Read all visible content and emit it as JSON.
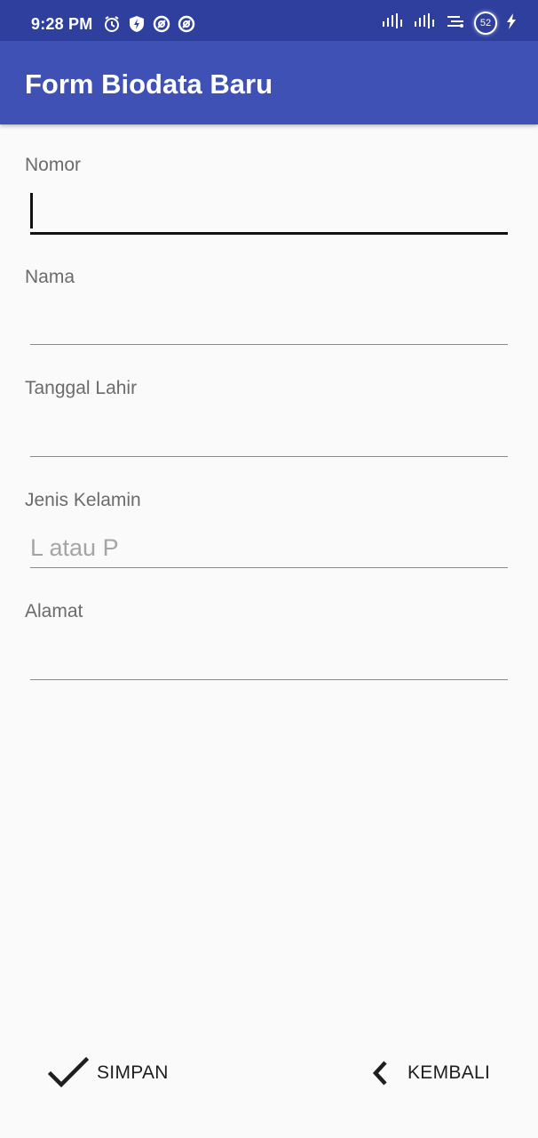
{
  "status_bar": {
    "time": "9:28 PM",
    "battery_level": "52",
    "icons_left": [
      "alarm-icon",
      "shield-bolt-icon",
      "at-sign-icon",
      "at-sign-icon"
    ],
    "icons_right": [
      "signal-icon",
      "signal-icon",
      "data-speed-icon",
      "battery-icon",
      "charging-bolt-icon"
    ]
  },
  "app_bar": {
    "title": "Form Biodata Baru",
    "color": "#3f51b5",
    "status_color": "#2f3f9e"
  },
  "form": {
    "fields": [
      {
        "label": "Nomor",
        "value": "",
        "placeholder": "",
        "focused": true
      },
      {
        "label": "Nama",
        "value": "",
        "placeholder": ""
      },
      {
        "label": "Tanggal Lahir",
        "value": "",
        "placeholder": ""
      },
      {
        "label": "Jenis Kelamin",
        "value": "",
        "placeholder": "L atau P"
      },
      {
        "label": "Alamat",
        "value": "",
        "placeholder": ""
      }
    ]
  },
  "actions": {
    "save_label": "SIMPAN",
    "save_icon": "check-icon",
    "back_label": "KEMBALI",
    "back_icon": "chevron-left-icon"
  }
}
